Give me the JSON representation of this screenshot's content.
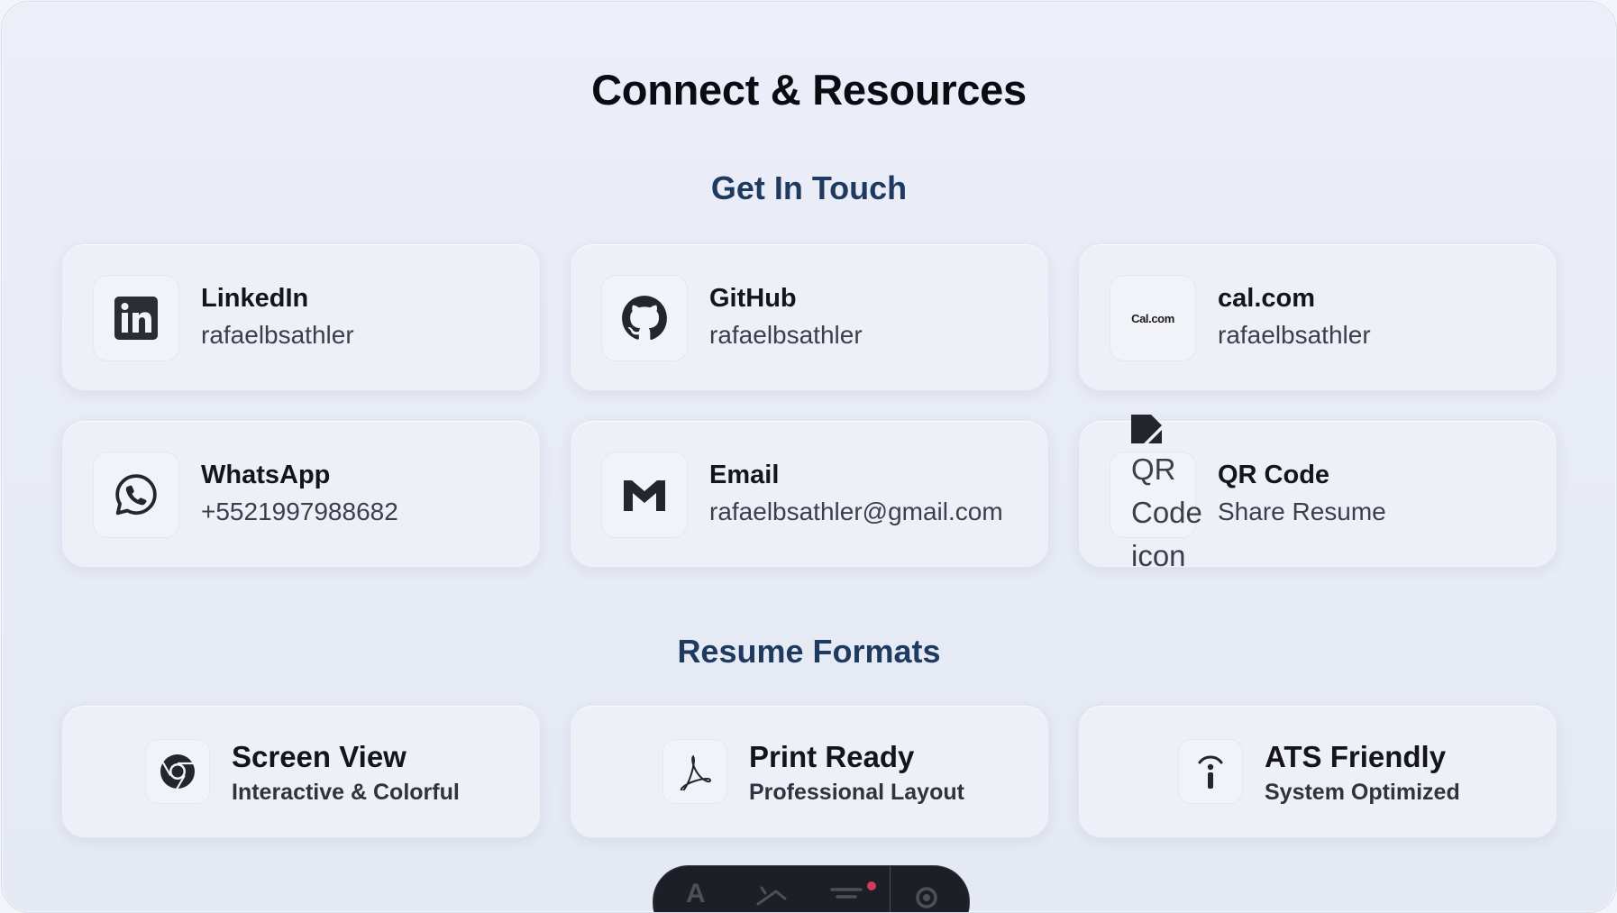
{
  "page_title": "Connect & Resources",
  "sections": {
    "contact_title": "Get In Touch",
    "formats_title": "Resume Formats"
  },
  "contacts": [
    {
      "name": "LinkedIn",
      "value": "rafaelbsathler",
      "icon": "linkedin-icon"
    },
    {
      "name": "GitHub",
      "value": "rafaelbsathler",
      "icon": "github-icon"
    },
    {
      "name": "cal.com",
      "value": "rafaelbsathler",
      "icon": "calcom-icon",
      "icon_text": "Cal.com"
    },
    {
      "name": "WhatsApp",
      "value": "+5521997988682",
      "icon": "whatsapp-icon"
    },
    {
      "name": "Email",
      "value": "rafaelbsathler@gmail.com",
      "icon": "gmail-icon"
    },
    {
      "name": "QR Code",
      "value": "Share Resume",
      "icon": "qr-code-icon",
      "alt_text": "QR Code icon"
    }
  ],
  "formats": [
    {
      "title": "Screen View",
      "subtitle": "Interactive & Colorful",
      "icon": "chrome-icon"
    },
    {
      "title": "Print Ready",
      "subtitle": "Professional Layout",
      "icon": "pdf-icon"
    },
    {
      "title": "ATS Friendly",
      "subtitle": "System Optimized",
      "icon": "info-icon"
    }
  ],
  "dock": {
    "icons": [
      "text-size-icon",
      "theme-icon",
      "filter-icon",
      "settings-icon"
    ],
    "accent": "#d43a55"
  },
  "colors": {
    "section_title": "#1f3a5f",
    "page_title": "#0b0b12"
  }
}
